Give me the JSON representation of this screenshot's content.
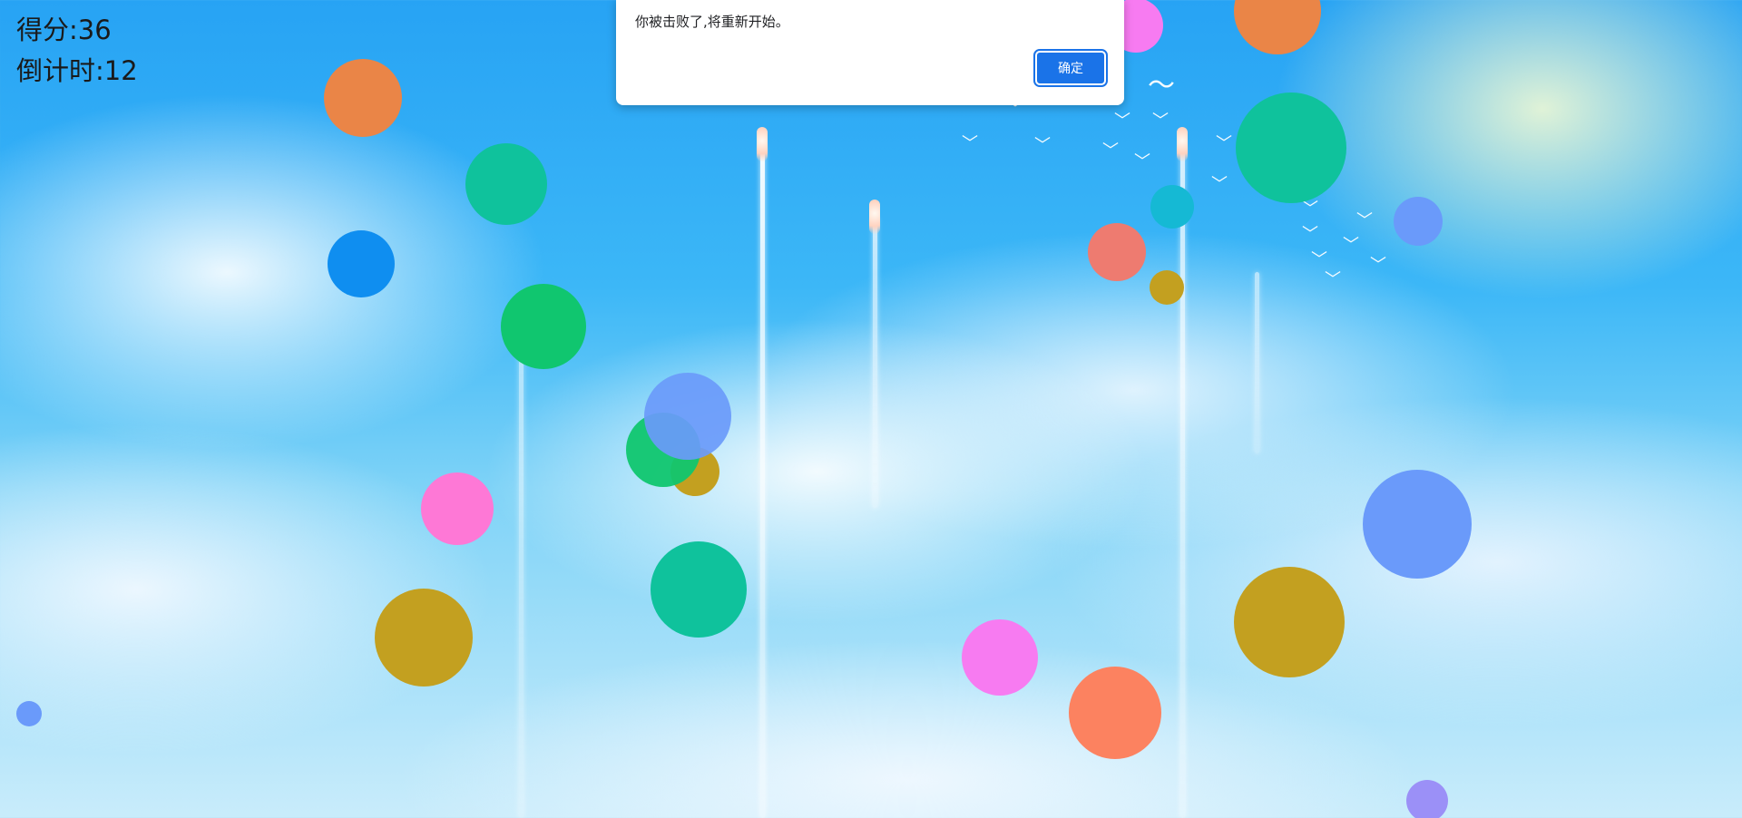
{
  "hud": {
    "score_text": "得分:36",
    "countdown_text": "倒计时:12"
  },
  "dialog": {
    "message": "你被击败了,将重新开始。",
    "ok_label": "确定"
  },
  "colors": {
    "orange": "#ea8547",
    "teal": "#0fc29c",
    "blue": "#0f8ef0",
    "green": "#10c66f",
    "periwinkle": "#6a9afa",
    "mustard": "#c3a020",
    "pink": "#fe78d6",
    "magenta": "#f77bf1",
    "coral": "#fc8260",
    "salmon": "#ee7b70",
    "cyan": "#15b9d4",
    "lavender": "#9b90f7",
    "accent_blue": "#1a73e8"
  }
}
